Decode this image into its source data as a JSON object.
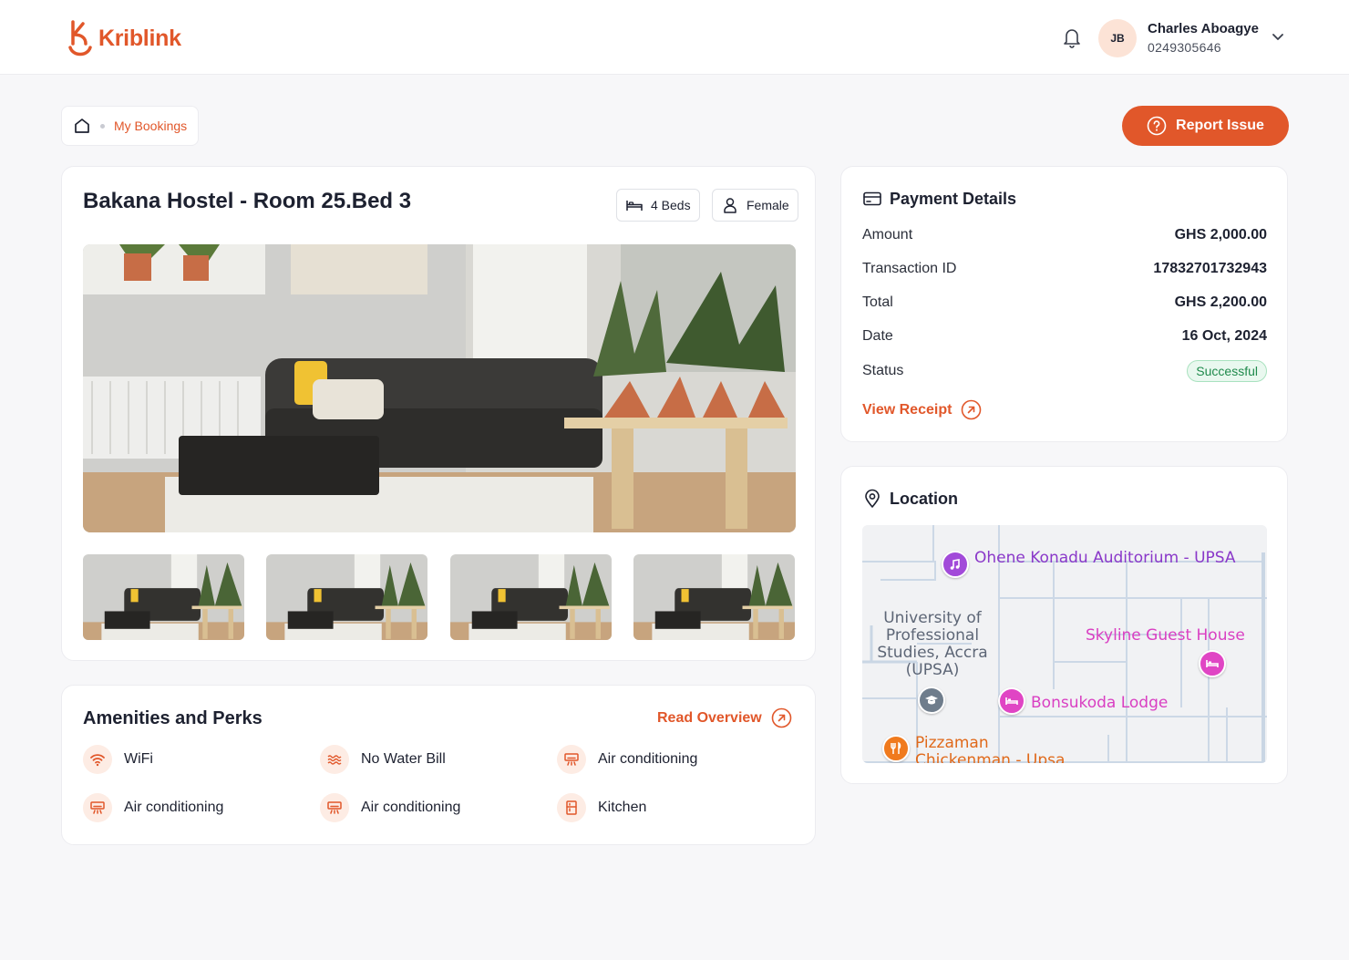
{
  "brand": {
    "name": "Kriblink",
    "accent": "#e1572a"
  },
  "user": {
    "initials": "JB",
    "name": "Charles Aboagye",
    "phone": "0249305646"
  },
  "breadcrumb": {
    "current": "My Bookings"
  },
  "actions": {
    "report_issue": "Report Issue"
  },
  "room": {
    "title": "Bakana Hostel - Room 25.Bed 3",
    "beds": "4 Beds",
    "gender": "Female",
    "photos": [
      "living-room-photo",
      "living-room-photo",
      "living-room-photo",
      "living-room-photo"
    ]
  },
  "amenities": {
    "title": "Amenities and Perks",
    "read_overview": "Read Overview",
    "items": [
      {
        "label": "WiFi",
        "icon": "wifi-icon"
      },
      {
        "label": "No Water Bill",
        "icon": "water-icon"
      },
      {
        "label": "Air conditioning",
        "icon": "air-conditioner-icon"
      },
      {
        "label": "Air conditioning",
        "icon": "air-conditioner-icon"
      },
      {
        "label": "Air conditioning",
        "icon": "air-conditioner-icon"
      },
      {
        "label": "Kitchen",
        "icon": "fridge-icon"
      }
    ]
  },
  "payment": {
    "title": "Payment Details",
    "rows": [
      {
        "label": "Amount",
        "value": "GHS 2,000.00"
      },
      {
        "label": "Transaction ID",
        "value": "17832701732943"
      },
      {
        "label": "Total",
        "value": "GHS 2,200.00"
      },
      {
        "label": "Date",
        "value": "16 Oct, 2024"
      },
      {
        "label": "Status",
        "value": "Successful"
      }
    ],
    "view_receipt": "View Receipt",
    "status_color": "#1f8a4c"
  },
  "location": {
    "title": "Location",
    "places": [
      "Ohene Konadu Auditorium - UPSA",
      "University of Professional Studies, Accra (UPSA)",
      "Skyline Guest House",
      "Bonsukoda Lodge",
      "Pizzaman Chickenman - Upsa"
    ]
  }
}
